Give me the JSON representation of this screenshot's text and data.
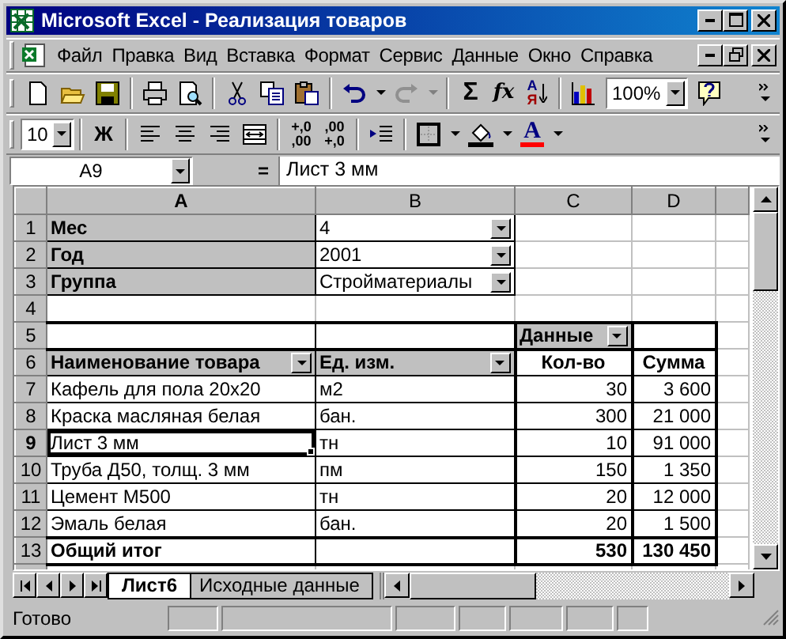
{
  "window": {
    "title": "Microsoft Excel - Реализация товаров"
  },
  "menu": [
    {
      "label": "Файл"
    },
    {
      "label": "Правка"
    },
    {
      "label": "Вид"
    },
    {
      "label": "Вставка"
    },
    {
      "label": "Формат"
    },
    {
      "label": "Сервис"
    },
    {
      "label": "Данные"
    },
    {
      "label": "Окно"
    },
    {
      "label": "Справка"
    }
  ],
  "standard_toolbar": {
    "sum": "Σ",
    "function": "fx",
    "sort": {
      "top": "А",
      "bottom": "Я"
    },
    "zoom": "100%"
  },
  "formatting_toolbar": {
    "font_size": "10",
    "bold": "Ж",
    "decimals": [
      {
        "top": "+,0",
        "bottom": ",00"
      },
      {
        "top": ",00",
        "bottom": "+,0"
      }
    ],
    "font_color": "A"
  },
  "formula_bar": {
    "name_box": "A9",
    "equals": "=",
    "content": "Лист 3 мм"
  },
  "columns": [
    {
      "label": "A",
      "selected": true
    },
    {
      "label": "B",
      "selected": false
    },
    {
      "label": "C",
      "selected": false
    },
    {
      "label": "D",
      "selected": false
    }
  ],
  "rows": [
    {
      "number": "1",
      "selected": false,
      "cells": [
        {
          "kind": "field",
          "text": "Мес",
          "selected": false
        },
        {
          "kind": "item",
          "text": "4",
          "dropdown": true,
          "selected": false
        },
        {
          "kind": "blank",
          "selected": false
        },
        {
          "kind": "blank",
          "selected": false
        }
      ]
    },
    {
      "number": "2",
      "selected": false,
      "cells": [
        {
          "kind": "field",
          "text": "Год",
          "selected": false
        },
        {
          "kind": "item",
          "text": "2001",
          "dropdown": true,
          "selected": false
        },
        {
          "kind": "blank",
          "selected": false
        },
        {
          "kind": "blank",
          "selected": false
        }
      ]
    },
    {
      "number": "3",
      "selected": false,
      "cells": [
        {
          "kind": "field",
          "text": "Группа",
          "selected": false
        },
        {
          "kind": "item",
          "text": "Стройматериалы",
          "dropdown": true,
          "selected": false
        },
        {
          "kind": "blank",
          "selected": false
        },
        {
          "kind": "blank",
          "selected": false
        }
      ]
    },
    {
      "number": "4",
      "selected": false,
      "cells": [
        {
          "kind": "blank",
          "selected": false
        },
        {
          "kind": "blank",
          "selected": false
        },
        {
          "kind": "blank",
          "selected": false
        },
        {
          "kind": "blank",
          "selected": false
        }
      ]
    },
    {
      "number": "5",
      "selected": false,
      "cells": [
        {
          "kind": "pivot",
          "selected": false
        },
        {
          "kind": "pivot",
          "selected": false
        },
        {
          "kind": "field",
          "text": "Данные",
          "dropdown": true,
          "selected": false
        },
        {
          "kind": "pivot",
          "selected": false
        }
      ]
    },
    {
      "number": "6",
      "selected": false,
      "cells": [
        {
          "kind": "field",
          "text": "Наименование товара",
          "dropdown": true,
          "selected": false
        },
        {
          "kind": "field",
          "text": "Ед. изм.",
          "dropdown": true,
          "selected": false
        },
        {
          "kind": "heading",
          "text": "Кол-во",
          "selected": false
        },
        {
          "kind": "heading",
          "text": "Сумма",
          "selected": false
        }
      ]
    },
    {
      "number": "7",
      "selected": false,
      "cells": [
        {
          "kind": "text",
          "text": "Кафель для пола 20x20",
          "selected": false
        },
        {
          "kind": "text",
          "text": "м2",
          "selected": false
        },
        {
          "kind": "number",
          "text": "30",
          "selected": false
        },
        {
          "kind": "number",
          "text": "3 600",
          "selected": false
        }
      ]
    },
    {
      "number": "8",
      "selected": false,
      "cells": [
        {
          "kind": "text",
          "text": "Краска масляная белая",
          "selected": false
        },
        {
          "kind": "text",
          "text": "бан.",
          "selected": false
        },
        {
          "kind": "number",
          "text": "300",
          "selected": false
        },
        {
          "kind": "number",
          "text": "21 000",
          "selected": false
        }
      ]
    },
    {
      "number": "9",
      "selected": true,
      "cells": [
        {
          "kind": "text",
          "text": "Лист 3 мм",
          "selected": true
        },
        {
          "kind": "text",
          "text": "тн",
          "selected": false
        },
        {
          "kind": "number",
          "text": "10",
          "selected": false
        },
        {
          "kind": "number",
          "text": "91 000",
          "selected": false
        }
      ]
    },
    {
      "number": "10",
      "selected": false,
      "cells": [
        {
          "kind": "text",
          "text": "Труба Д50, толщ. 3 мм",
          "selected": false
        },
        {
          "kind": "text",
          "text": "пм",
          "selected": false
        },
        {
          "kind": "number",
          "text": "150",
          "selected": false
        },
        {
          "kind": "number",
          "text": "1 350",
          "selected": false
        }
      ]
    },
    {
      "number": "11",
      "selected": false,
      "cells": [
        {
          "kind": "text",
          "text": "Цемент М500",
          "selected": false
        },
        {
          "kind": "text",
          "text": "тн",
          "selected": false
        },
        {
          "kind": "number",
          "text": "20",
          "selected": false
        },
        {
          "kind": "number",
          "text": "12 000",
          "selected": false
        }
      ]
    },
    {
      "number": "12",
      "selected": false,
      "cells": [
        {
          "kind": "text",
          "text": "Эмаль белая",
          "selected": false
        },
        {
          "kind": "text",
          "text": "бан.",
          "selected": false
        },
        {
          "kind": "number",
          "text": "20",
          "selected": false
        },
        {
          "kind": "number",
          "text": "1 500",
          "selected": false
        }
      ]
    },
    {
      "number": "13",
      "selected": false,
      "cells": [
        {
          "kind": "total",
          "text": "Общий итог",
          "selected": false
        },
        {
          "kind": "totalblank",
          "selected": false
        },
        {
          "kind": "totalnum",
          "text": "530",
          "selected": false
        },
        {
          "kind": "totalnum",
          "text": "130 450",
          "selected": false
        }
      ]
    }
  ],
  "sheet_tabs": [
    {
      "label": "Лист6",
      "selected": true
    },
    {
      "label": "Исходные данные",
      "selected": false
    }
  ],
  "status_bar": {
    "text": "Готово"
  }
}
